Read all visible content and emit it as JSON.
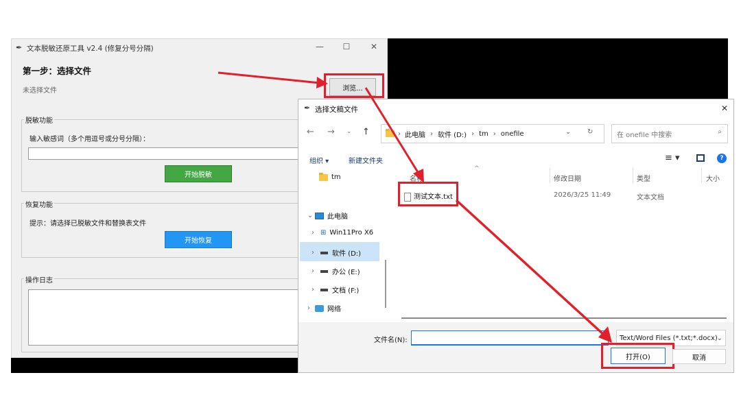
{
  "app": {
    "title": "文本脱敏还原工具 v2.4 (修复分号分隔)",
    "step1": "第一步：选择文件",
    "no_file": "未选择文件",
    "browse_label": "浏览...",
    "desens_group": "脱敏功能",
    "desens_prompt": "输入敏感词（多个用逗号或分号分隔）：",
    "desens_value": "",
    "start_desens": "开始脱敏",
    "restore_group": "恢复功能",
    "restore_hint": "提示：请选择已脱敏文件和替换表文件",
    "start_restore": "开始恢复",
    "log_group": "操作日志",
    "log_value": "",
    "win_min": "—",
    "win_max": "☐",
    "win_close": "✕"
  },
  "dialog": {
    "title": "选择文稿文件",
    "close": "✕",
    "breadcrumb": [
      "此电脑",
      "软件 (D:)",
      "tm",
      "onefile"
    ],
    "search_placeholder": "在 onefile 中搜索",
    "toolbar": {
      "organize": "组织 ▾",
      "new_folder": "新建文件夹"
    },
    "tree": [
      {
        "label": "tm",
        "icon": "folder-icon"
      },
      {
        "label": "此电脑",
        "icon": "pc-icon"
      },
      {
        "label": "Win11Pro X6",
        "icon": "network-drive-icon"
      },
      {
        "label": "软件 (D:)",
        "icon": "drive-icon"
      },
      {
        "label": "办公 (E:)",
        "icon": "drive-icon"
      },
      {
        "label": "文档 (F:)",
        "icon": "drive-icon"
      },
      {
        "label": "网络",
        "icon": "network-icon"
      }
    ],
    "columns": [
      "名称",
      "修改日期",
      "类型",
      "大小"
    ],
    "files": [
      {
        "name": "测试文本.txt",
        "date": "2026/3/25 11:49",
        "type": "文本文档",
        "size": ""
      }
    ],
    "filename_label": "文件名(N):",
    "filename_value": "",
    "filetype": "Text/Word Files (*.txt;*.docx)",
    "open_label": "打开(O)",
    "cancel_label": "取消"
  },
  "colors": {
    "annotation": "#e0202a",
    "green_button": "#43a843",
    "blue_button": "#2196f3"
  }
}
